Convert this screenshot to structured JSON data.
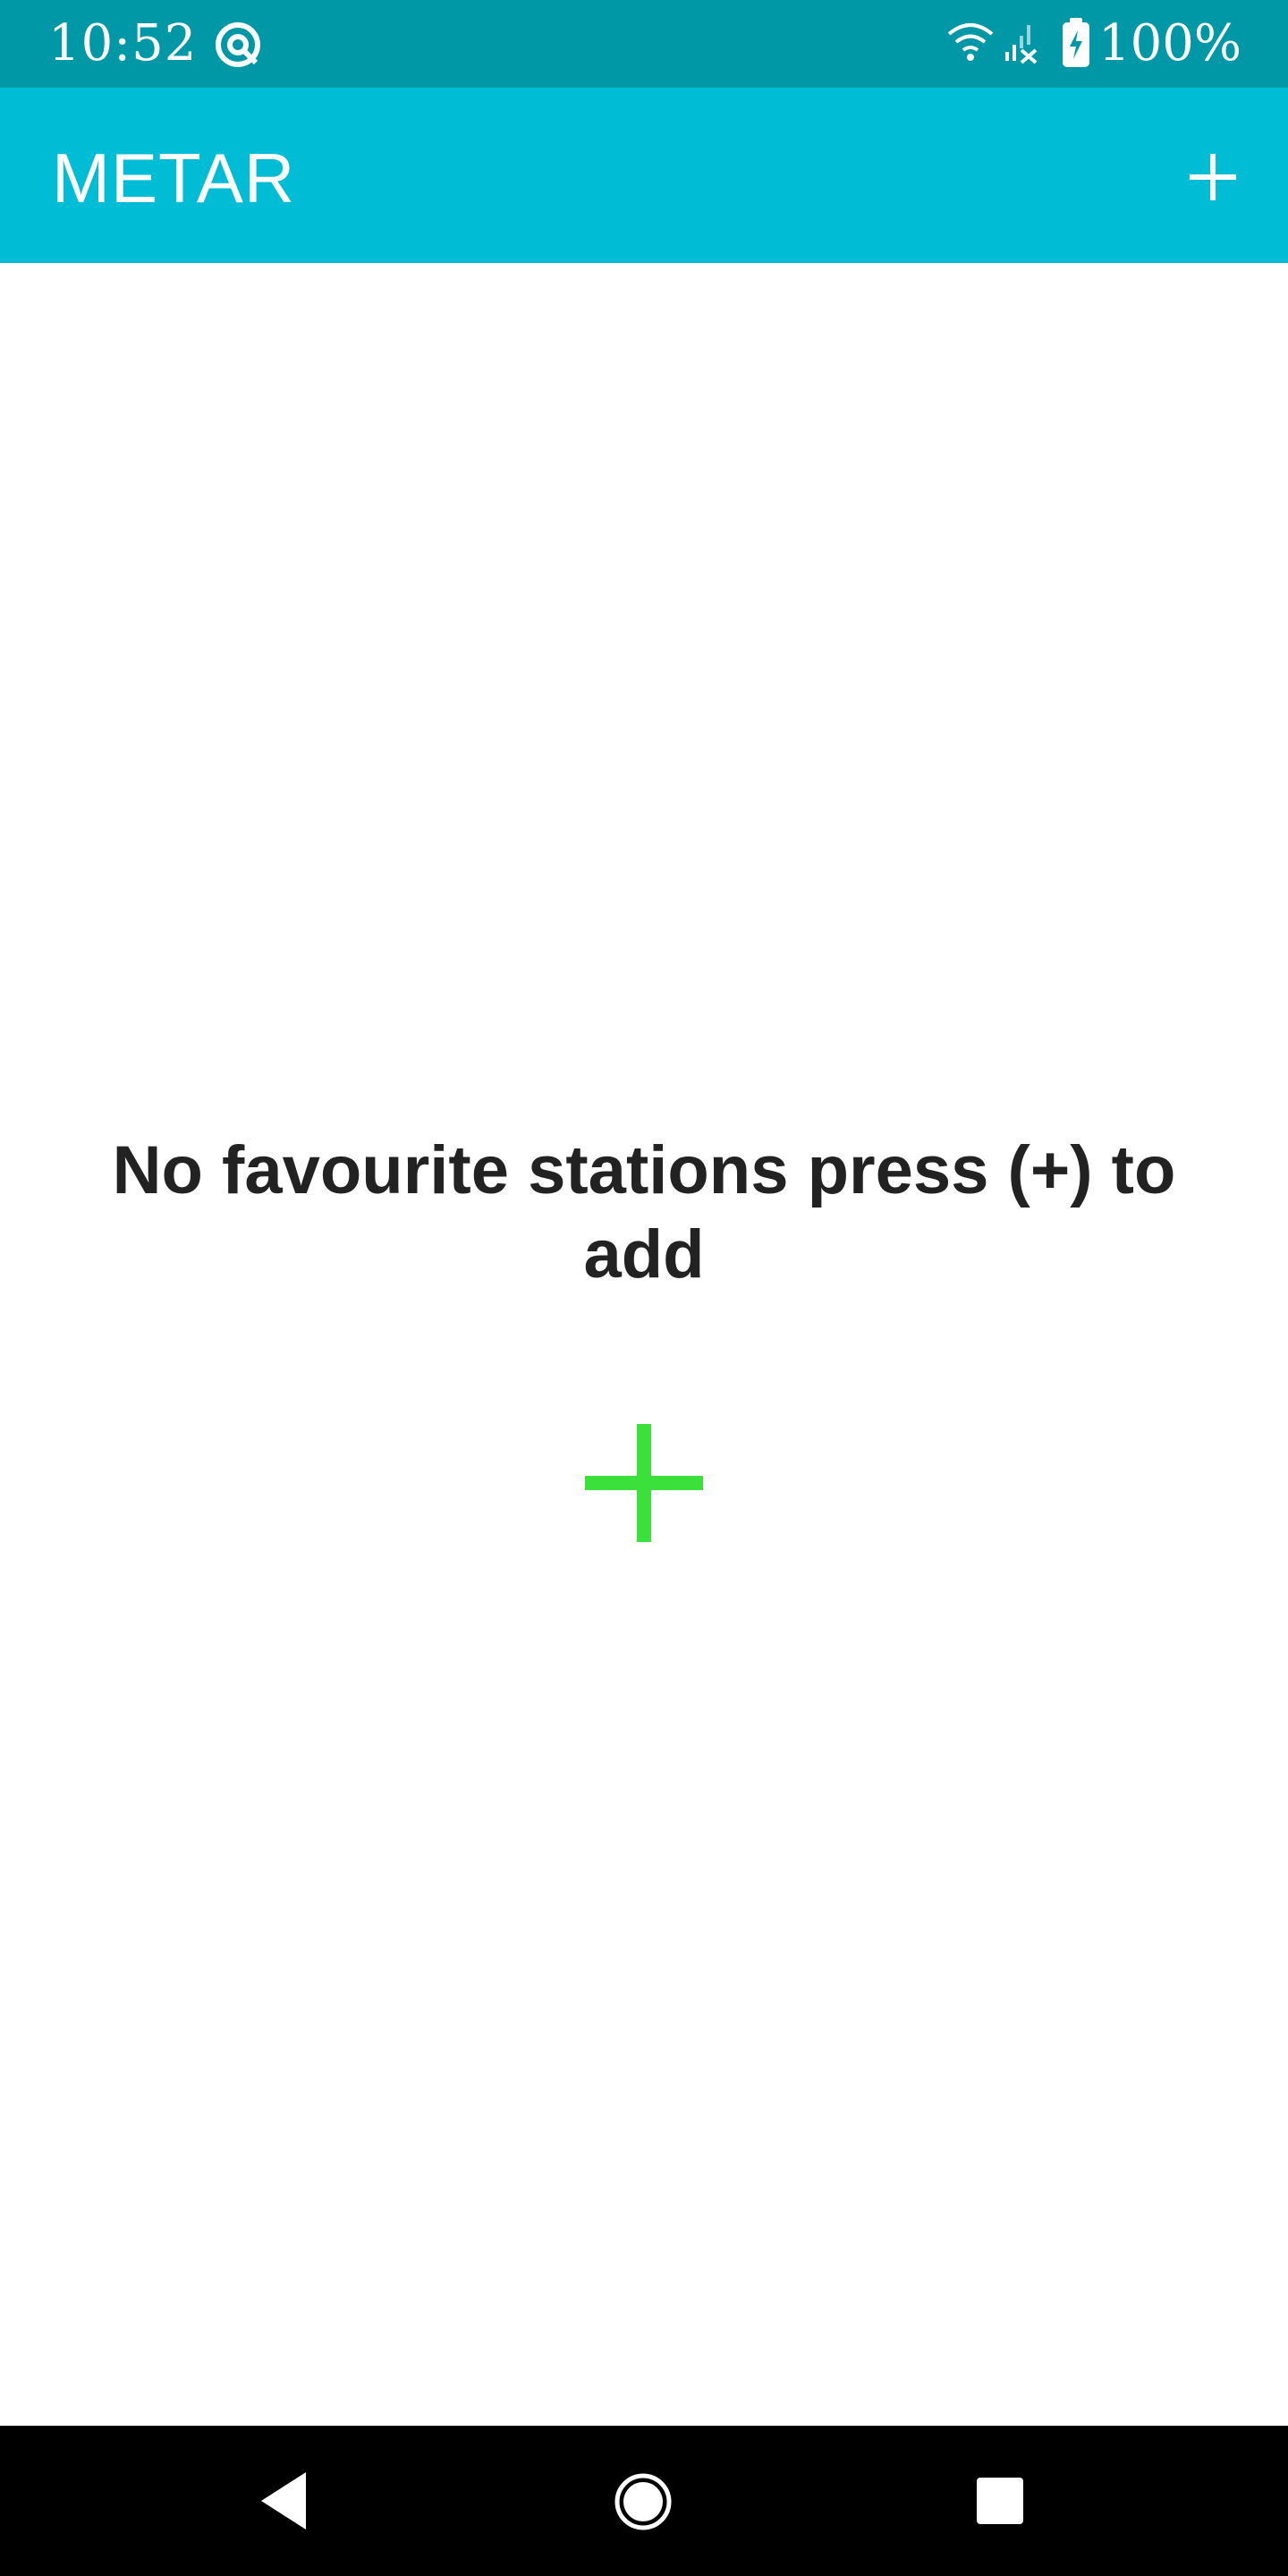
{
  "status_bar": {
    "time": "10:52",
    "battery": "100%",
    "background": "#0097A7",
    "icons": [
      "at-sign-icon",
      "wifi-icon",
      "signal-icon",
      "battery-charging-icon"
    ]
  },
  "app_bar": {
    "title": "METAR",
    "background": "#00BCD4",
    "action_icon": "plus-icon"
  },
  "empty_state": {
    "message": "No favourite stations press (+) to add",
    "add_icon": "plus-icon",
    "add_icon_color": "#3BE03B"
  },
  "nav_bar": {
    "background": "#000000",
    "icons": [
      "back-icon",
      "home-icon",
      "recents-icon"
    ]
  }
}
